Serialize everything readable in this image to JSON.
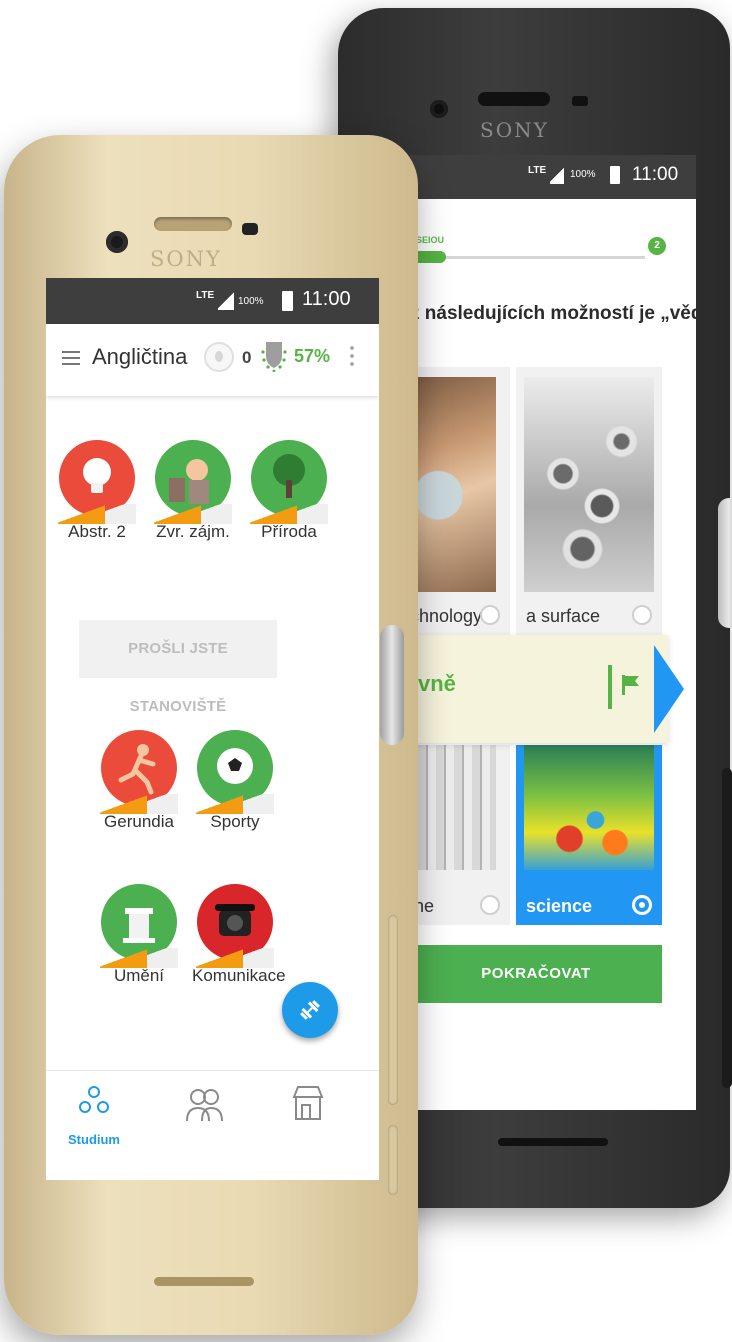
{
  "back_phone": {
    "brand": "SONY",
    "status": {
      "network": "LTE",
      "battery": "100%",
      "time": "11:00"
    },
    "progress": {
      "label": "SEIOU",
      "step": "2",
      "fill": 0.15
    },
    "question": "z následujících možností je „věda“?",
    "options": [
      {
        "caption": "chnology",
        "selected": false
      },
      {
        "caption": "a surface",
        "selected": false
      },
      {
        "caption": "ine",
        "selected": false
      },
      {
        "caption": "science",
        "selected": true
      }
    ],
    "feedback": {
      "text": "vně",
      "icon": "flag-icon"
    },
    "continue_label": "POKRAČOVAT",
    "colors": {
      "green": "#55b443",
      "blue": "#2196f3"
    }
  },
  "front_phone": {
    "brand": "SONY",
    "status": {
      "network": "LTE",
      "battery": "100%",
      "time": "11:00"
    },
    "appbar": {
      "title": "Angličtina",
      "lingots": "0",
      "goal_percent": "57%"
    },
    "skills_top": [
      {
        "label": "Abstr. 2",
        "color": "#ea4b3b",
        "icon": "lightbulb-icon"
      },
      {
        "label": "Zvr. zájm.",
        "color": "#4caf50",
        "icon": "person-icon"
      },
      {
        "label": "Příroda",
        "color": "#4caf50",
        "icon": "tree-icon"
      }
    ],
    "checkpoint_label": "PROŠLI JSTE STANOVIŠTĚ",
    "skills_bottom": [
      {
        "label": "Gerundia",
        "color": "#ea4b3b",
        "icon": "runner-icon"
      },
      {
        "label": "Sporty",
        "color": "#4caf50",
        "icon": "soccer-ball-icon"
      },
      {
        "label": "Umění",
        "color": "#4caf50",
        "icon": "column-icon"
      },
      {
        "label": "Komunikace",
        "color": "#d9262b",
        "icon": "telephone-icon"
      }
    ],
    "bottom_nav": [
      {
        "label": "Studium",
        "icon": "study-icon",
        "active": true
      },
      {
        "label": "",
        "icon": "friends-icon",
        "active": false
      },
      {
        "label": "",
        "icon": "shop-icon",
        "active": false
      }
    ],
    "colors": {
      "green": "#55b443",
      "blue": "#1e9be8",
      "orange": "#f39c12"
    }
  }
}
